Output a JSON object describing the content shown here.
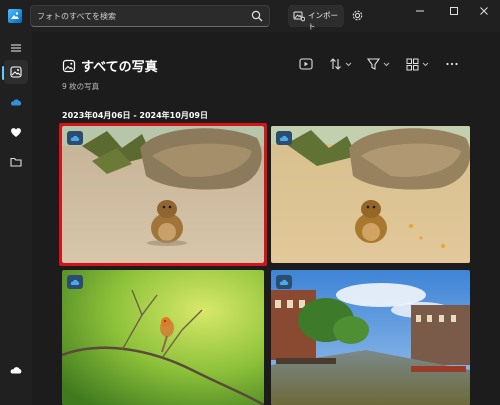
{
  "app": {
    "search": {
      "placeholder": "フォトのすべてを検索"
    },
    "import_label": "インポート"
  },
  "icons": {
    "app": "photos-app-icon",
    "search": "search-icon",
    "import": "import-icon",
    "settings": "gear-icon",
    "minimize": "minimize-icon",
    "maximize": "maximize-icon",
    "close": "close-icon",
    "menu": "hamburger-menu-icon",
    "all_photos": "photos-icon",
    "onedrive": "cloud-icon",
    "favorites": "heart-icon",
    "folders": "folder-icon",
    "bottom_cloud": "cloud-icon",
    "slideshow": "slideshow-icon",
    "sort": "sort-icon",
    "filter": "filter-icon",
    "view": "view-layout-icon",
    "more": "more-icon"
  },
  "main": {
    "title": "すべての写真",
    "count": "9 枚の写真",
    "date_range": "2023年04月06日 - 2024年10月09日"
  },
  "photos": [
    {
      "subject": "squirrel",
      "selected": true,
      "cloud": true
    },
    {
      "subject": "squirrel",
      "selected": false,
      "cloud": true
    },
    {
      "subject": "bird",
      "selected": false,
      "cloud": true
    },
    {
      "subject": "canal",
      "selected": false,
      "cloud": true
    }
  ],
  "colors": {
    "accent": "#60cdff",
    "selection": "#d4141a",
    "background": "#1c1c1c",
    "favorites": "#ffffff"
  }
}
